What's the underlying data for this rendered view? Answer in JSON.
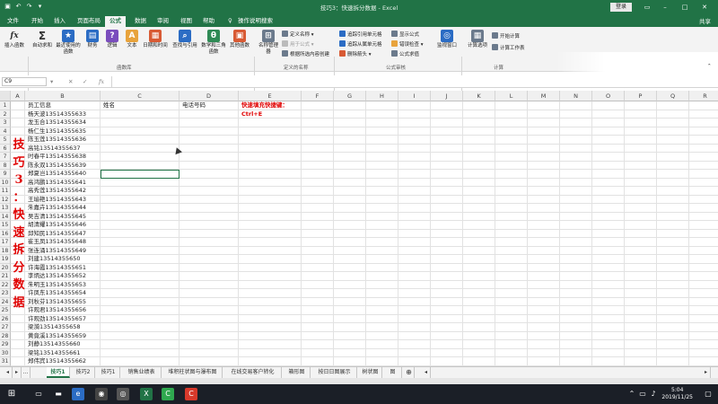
{
  "window": {
    "title": "技巧3：快速拆分数据  -  Excel",
    "login": "登录",
    "share": "共享"
  },
  "menu": [
    "文件",
    "开始",
    "插入",
    "页面布局",
    "公式",
    "数据",
    "审阅",
    "视图",
    "帮助",
    "操作说明搜索"
  ],
  "ribbon": {
    "insert_function": "插入函数",
    "lib_buttons": [
      "自动求和",
      "最近使用的函数",
      "财务",
      "逻辑",
      "文本",
      "日期和时间",
      "查找与引用",
      "数学和三角函数",
      "其他函数"
    ],
    "lib_group": "函数库",
    "name_manager": "名称管理器",
    "define_name": "定义名称",
    "use_in_formula": "用于公式",
    "create_from_selection": "根据所选内容创建",
    "names_group": "定义的名称",
    "trace_precedents": "追踪引用单元格",
    "trace_dependents": "追踪从属单元格",
    "remove_arrows": "删除箭头",
    "show_formulas": "显示公式",
    "error_checking": "错误检查",
    "evaluate_formula": "公式求值",
    "audit_group": "公式审核",
    "watch_window": "监视窗口",
    "calc_options": "计算选项",
    "calc_now": "开始计算",
    "calc_sheet": "计算工作表",
    "calc_group": "计算"
  },
  "formula_bar": {
    "name_box": "C9",
    "fx": "fx"
  },
  "columns": [
    "A",
    "B",
    "C",
    "D",
    "E",
    "F",
    "G",
    "H",
    "I",
    "J",
    "K",
    "L",
    "M",
    "N",
    "O",
    "P",
    "Q",
    "R"
  ],
  "header_row": {
    "b": "员工信息",
    "c": "姓名",
    "d": "电话号码",
    "e1": "快速填充快捷键：",
    "e2": "Ctrl+E"
  },
  "side_title": [
    "技",
    "巧",
    "3",
    "：",
    "快",
    "速",
    "拆",
    "分",
    "数",
    "据"
  ],
  "rows": [
    "杨天波13514355633",
    "龙玉合13514355634",
    "杨仁生13514355635",
    "陈玉莲13514355636",
    "高铭13514355637",
    "时春平13514355638",
    "陈永双13514355639",
    "郑夏岂13514355640",
    "高鸿鹏13514355641",
    "高秀莲13514355642",
    "王瑜艳13514355643",
    "朱嘉卉13514355644",
    "吴吉清13514355645",
    "胡清耀13514355646",
    "邱知民13514355647",
    "崔玉凤13514355648",
    "张连涌13514355649",
    "刘建13514355650",
    "许海霞13514355651",
    "李炳达13514355652",
    "朱明玉13514355653",
    "许凤东13514355654",
    "刘秋芬13514355655",
    "许观君13514355656",
    "许观劲13514355657",
    "梁漪13514355658",
    "黄竟溪13514355659",
    "刘静13514355660",
    "梁铭13514355661",
    "郑伟宾13514355662"
  ],
  "sheets": [
    "技巧1",
    "技巧2",
    "技巧1",
    "销售业绩表",
    "堆积柱状图与瀑布图",
    "在线交易客户转化",
    "箱形图",
    "按日日图展示",
    "树状图",
    "图"
  ],
  "clock": {
    "time": "5:04",
    "date": "2019/11/25"
  },
  "colors": {
    "excel_green": "#217346",
    "accent_red": "#e00000"
  }
}
